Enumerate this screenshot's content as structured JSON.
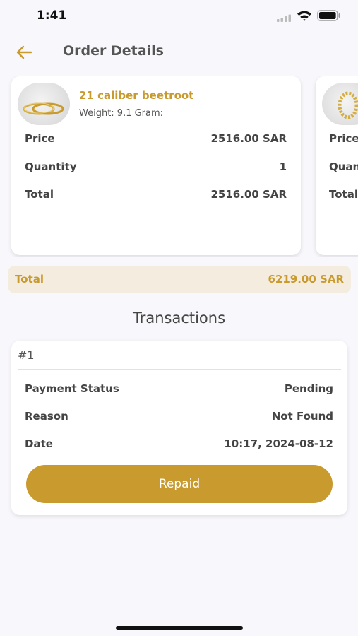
{
  "status_bar": {
    "time": "1:41"
  },
  "header": {
    "title": "Order Details"
  },
  "products": [
    {
      "name": "21 caliber beetroot",
      "weight": "Weight: 9.1 Gram:",
      "price_label": "Price",
      "price_value": "2516.00 SAR",
      "quantity_label": "Quantity",
      "quantity_value": "1",
      "total_label": "Total",
      "total_value": "2516.00 SAR"
    },
    {
      "price_label": "Price",
      "quantity_label": "Quantity",
      "total_label": "Total"
    }
  ],
  "order_total": {
    "label": "Total",
    "value": "6219.00 SAR"
  },
  "transactions": {
    "title": "Transactions",
    "items": [
      {
        "number": "#1",
        "payment_status_label": "Payment Status",
        "payment_status_value": "Pending",
        "reason_label": "Reason",
        "reason_value": "Not Found",
        "date_label": "Date",
        "date_value": "10:17, 2024-08-12",
        "action_label": "Repaid"
      }
    ]
  },
  "colors": {
    "accent": "#c99a2e",
    "total_bg": "#f4eddf",
    "background": "#f8f7fb"
  },
  "icons": {
    "back": "arrow-left-icon",
    "signal": "signal-icon",
    "wifi": "wifi-icon",
    "battery": "battery-icon"
  }
}
